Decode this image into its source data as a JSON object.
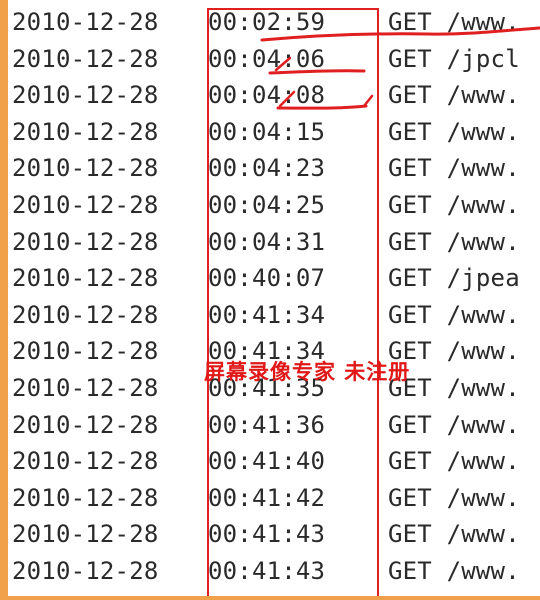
{
  "log": {
    "rows": [
      {
        "date": "2010-12-28",
        "time": "00:02:59",
        "request": "GET /www."
      },
      {
        "date": "2010-12-28",
        "time": "00:04:06",
        "request": "GET /jpcl"
      },
      {
        "date": "2010-12-28",
        "time": "00:04:08",
        "request": "GET /www."
      },
      {
        "date": "2010-12-28",
        "time": "00:04:15",
        "request": "GET /www."
      },
      {
        "date": "2010-12-28",
        "time": "00:04:23",
        "request": "GET /www."
      },
      {
        "date": "2010-12-28",
        "time": "00:04:25",
        "request": "GET /www."
      },
      {
        "date": "2010-12-28",
        "time": "00:04:31",
        "request": "GET /www."
      },
      {
        "date": "2010-12-28",
        "time": "00:40:07",
        "request": "GET /jpea"
      },
      {
        "date": "2010-12-28",
        "time": "00:41:34",
        "request": "GET /www."
      },
      {
        "date": "2010-12-28",
        "time": "00:41:34",
        "request": "GET /www."
      },
      {
        "date": "2010-12-28",
        "time": "00:41:35",
        "request": "GET /www."
      },
      {
        "date": "2010-12-28",
        "time": "00:41:36",
        "request": "GET /www."
      },
      {
        "date": "2010-12-28",
        "time": "00:41:40",
        "request": "GET /www."
      },
      {
        "date": "2010-12-28",
        "time": "00:41:42",
        "request": "GET /www."
      },
      {
        "date": "2010-12-28",
        "time": "00:41:43",
        "request": "GET /www."
      },
      {
        "date": "2010-12-28",
        "time": "00:41:43",
        "request": "GET /www."
      }
    ]
  },
  "watermark": {
    "text": "屏幕录像专家 未注册"
  },
  "colors": {
    "frame": "#f0a14a",
    "annotation_red": "#e02020",
    "text": "#2a2a2a"
  }
}
